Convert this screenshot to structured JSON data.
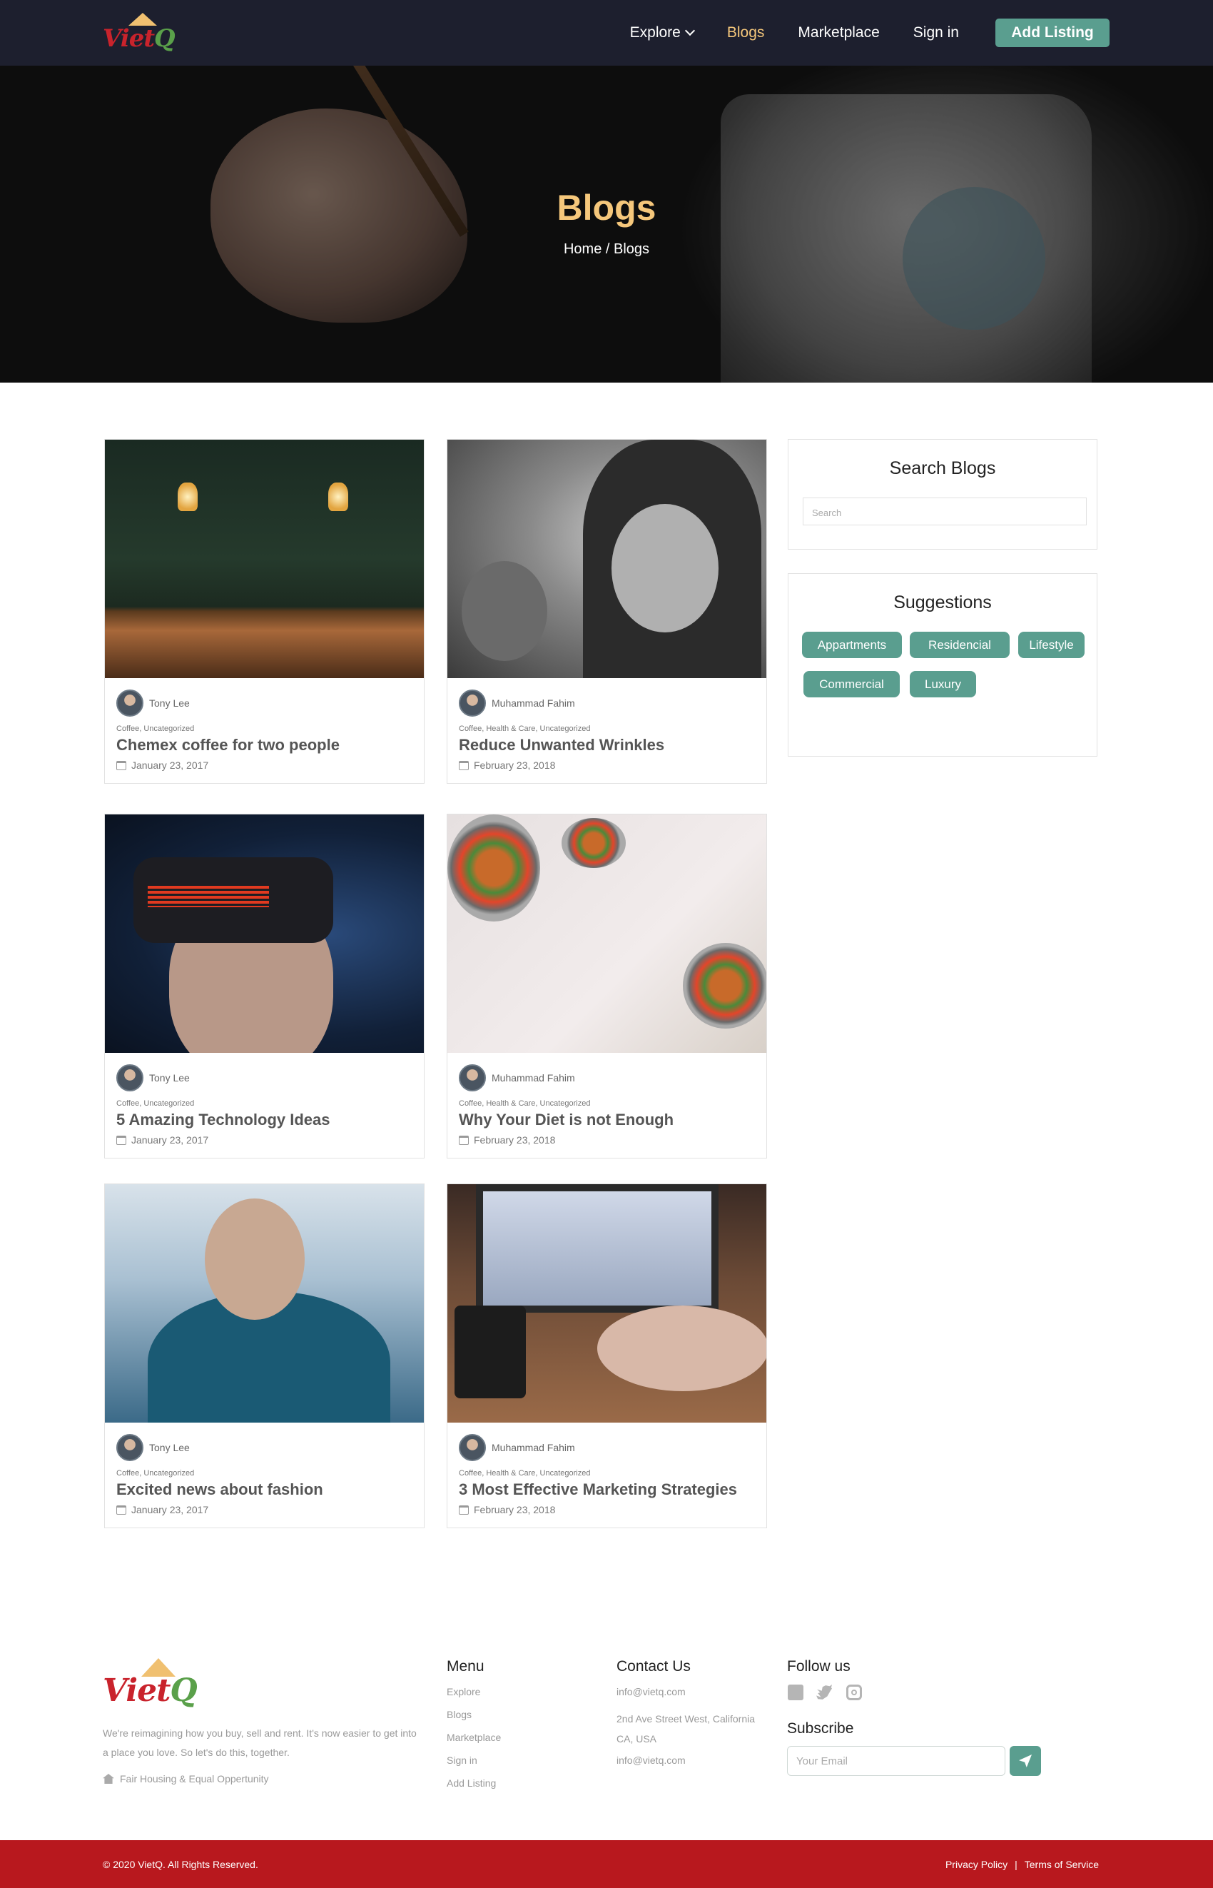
{
  "brand": {
    "logo_text": "Viet",
    "logo_q": "Q"
  },
  "nav": {
    "items": [
      {
        "label": "Explore",
        "has_dropdown": true,
        "active": false
      },
      {
        "label": "Blogs",
        "active": true
      },
      {
        "label": "Marketplace",
        "active": false
      },
      {
        "label": "Sign in",
        "active": false
      }
    ],
    "cta_label": "Add Listing"
  },
  "hero": {
    "title": "Blogs",
    "breadcrumb": "Home / Blogs"
  },
  "posts": [
    {
      "author": "Tony Lee",
      "categories": "Coffee, Uncategorized",
      "title": "Chemex coffee for two people",
      "date": "January 23, 2017"
    },
    {
      "author": "Muhammad Fahim",
      "categories": "Coffee, Health & Care, Uncategorized",
      "title": "Reduce Unwanted Wrinkles",
      "date": "February 23, 2018"
    },
    {
      "author": "Tony Lee",
      "categories": "Coffee, Uncategorized",
      "title": "5 Amazing Technology Ideas",
      "date": "January 23, 2017"
    },
    {
      "author": "Muhammad Fahim",
      "categories": "Coffee, Health & Care, Uncategorized",
      "title": "Why Your Diet is not Enough",
      "date": "February 23, 2018"
    },
    {
      "author": "Tony Lee",
      "categories": "Coffee, Uncategorized",
      "title": "Excited news about fashion",
      "date": "January 23, 2017"
    },
    {
      "author": "Muhammad Fahim",
      "categories": "Coffee, Health & Care, Uncategorized",
      "title": "3 Most Effective Marketing Strategies",
      "date": "February 23, 2018"
    }
  ],
  "sidebar": {
    "search_title": "Search Blogs",
    "search_placeholder": "Search",
    "suggestions_title": "Suggestions",
    "tags": [
      "Appartments",
      "Residencial",
      "Lifestyle",
      "Commercial",
      "Luxury"
    ]
  },
  "footer": {
    "about": "We're reimagining how you buy, sell and rent. It's now easier to get into a place you love. So let's do this, together.",
    "fair_housing": "Fair Housing & Equal Oppertunity",
    "menu_title": "Menu",
    "menu_items": [
      "Explore",
      "Blogs",
      "Marketplace",
      "Sign in",
      "Add Listing"
    ],
    "contact_title": "Contact Us",
    "contact_email": "info@vietq.com",
    "contact_address": "2nd Ave Street West, California CA, USA",
    "contact_email_2": "info@vietq.com",
    "follow_title": "Follow us",
    "social_icons": [
      "facebook-icon",
      "twitter-icon",
      "instagram-icon"
    ],
    "subscribe_title": "Subscribe",
    "email_placeholder": "Your Email",
    "copyright": "© 2020 VietQ. All Rights Reserved.",
    "privacy": "Privacy Policy",
    "terms": "Terms of Service"
  },
  "colors": {
    "nav_bg": "#1d1f2e",
    "accent": "#5a9e8f",
    "highlight": "#f5c77b",
    "footer_bar": "#b8181e"
  }
}
